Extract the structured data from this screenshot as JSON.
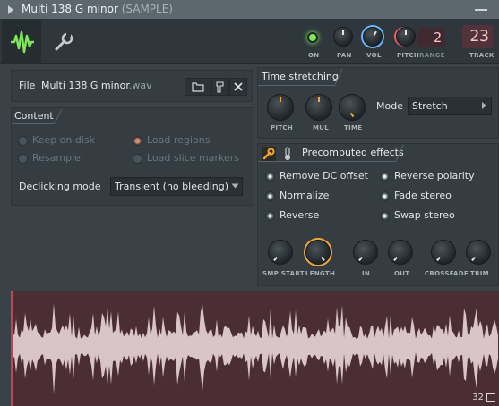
{
  "window": {
    "title": "Multi 138 G minor",
    "subtitle": "(SAMPLE)"
  },
  "toolbar": {
    "on_label": "ON",
    "pan_label": "PAN",
    "vol_label": "VOL",
    "pitch_label": "PITCH",
    "range_label": "RANGE",
    "range_value": "2",
    "track_label": "TRACK",
    "track_value": "23"
  },
  "file": {
    "label": "File",
    "name": "Multi 138 G minor",
    "extension": ".wav"
  },
  "content": {
    "heading": "Content",
    "options": {
      "keep_on_disk": "Keep on disk",
      "load_regions": "Load regions",
      "resample": "Resample",
      "load_slice_markers": "Load slice markers"
    },
    "declicking_label": "Declicking mode",
    "declicking_value": "Transient (no bleeding)"
  },
  "time_stretching": {
    "heading": "Time stretching",
    "pitch_label": "PITCH",
    "mul_label": "MUL",
    "time_label": "TIME",
    "mode_label": "Mode",
    "mode_value": "Stretch"
  },
  "precomputed": {
    "heading": "Precomputed effects",
    "options": {
      "remove_dc": "Remove DC offset",
      "reverse_polarity": "Reverse polarity",
      "normalize": "Normalize",
      "fade_stereo": "Fade stereo",
      "reverse": "Reverse",
      "swap_stereo": "Swap stereo"
    },
    "knobs": {
      "smp_start": "SMP START",
      "length": "LENGTH",
      "in": "IN",
      "out": "OUT",
      "crossfade": "CROSSFADE",
      "trim": "TRIM"
    }
  },
  "waveform": {
    "counter": "32"
  },
  "colors": {
    "accent_green": "#7ee65a",
    "accent_blue": "#6bb7ff",
    "accent_orange": "#f1a63a",
    "wave_bg": "#4a2e33",
    "wave_fill": "#d9c5c9"
  }
}
